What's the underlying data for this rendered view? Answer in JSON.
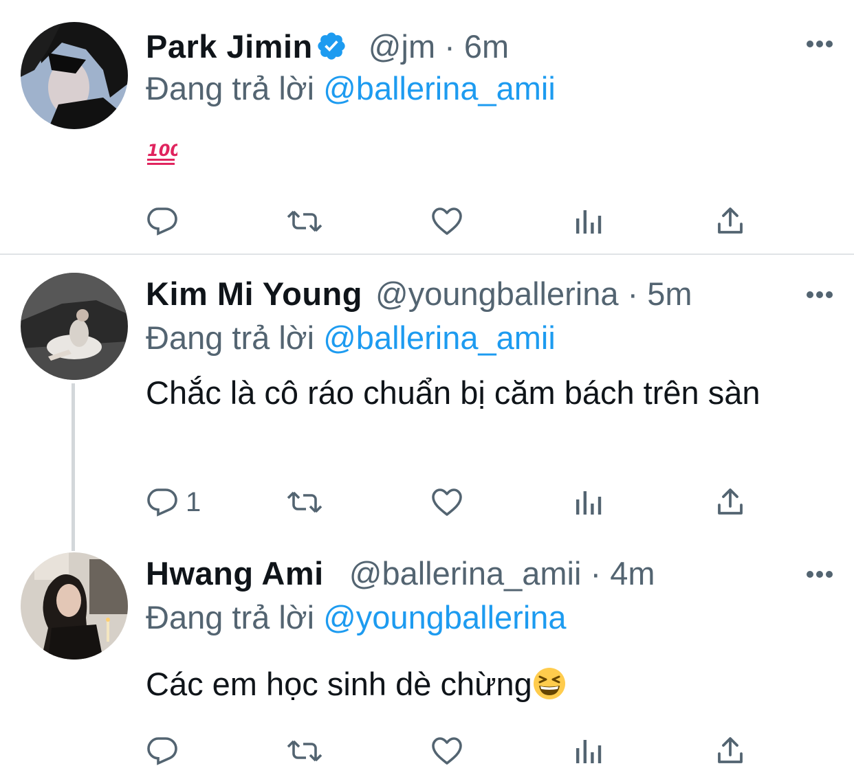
{
  "tweets": [
    {
      "name": "Park Jimin",
      "verified": true,
      "handle": "@jm",
      "separator": "·",
      "time": "6m",
      "reply_prefix": "Đang trả lời",
      "reply_to": "@ballerina_amii",
      "text": "",
      "emoji": "hundred-points-emoji",
      "reply_count": "",
      "avatar": "avatar-park-jimin"
    },
    {
      "name": "Kim Mi Young",
      "verified": false,
      "handle": "@youngballerina",
      "separator": "·",
      "time": "5m",
      "reply_prefix": "Đang trả lời",
      "reply_to": "@ballerina_amii",
      "text": "Chắc là cô ráo chuẩn bị căm bách trên sàn",
      "reply_count": "1",
      "avatar": "avatar-kim-mi-young"
    },
    {
      "name": "Hwang Ami",
      "verified": false,
      "handle": "@ballerina_amii",
      "separator": "·",
      "time": "4m",
      "reply_prefix": "Đang trả lời",
      "reply_to": "@youngballerina",
      "text": "Các em học sinh dè chừng",
      "emoji": "grinning-squinting-face-emoji",
      "reply_count": "",
      "avatar": "avatar-hwang-ami"
    }
  ],
  "icons": {
    "reply": "reply-icon",
    "retweet": "retweet-icon",
    "like": "like-icon",
    "analytics": "analytics-icon",
    "share": "share-icon",
    "more": "more-icon",
    "verified": "verified-badge-icon"
  },
  "colors": {
    "link": "#1d9bf0",
    "secondary_text": "#536471",
    "primary_text": "#0f1419",
    "verified_badge": "#1d9bf0",
    "divider": "#dfe3e6"
  }
}
